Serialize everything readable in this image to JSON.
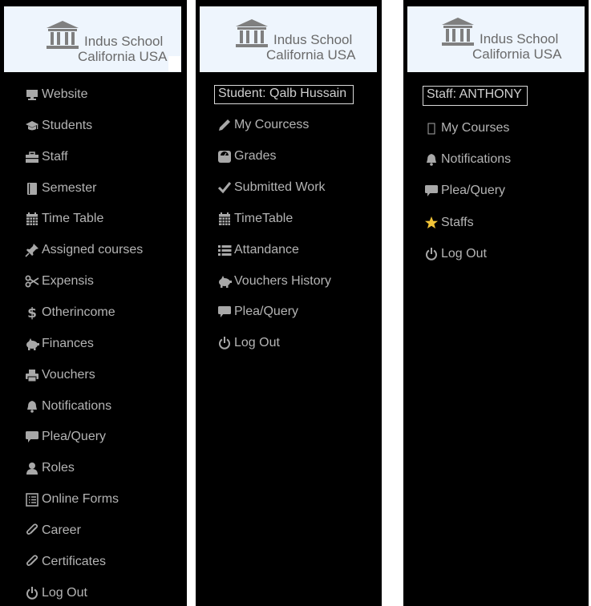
{
  "school": {
    "name": "Indus School",
    "location": "California USA"
  },
  "admin": {
    "items": [
      {
        "label": "Website",
        "icon": "monitor-icon"
      },
      {
        "label": "Students",
        "icon": "graduation-cap-icon"
      },
      {
        "label": "Staff",
        "icon": "briefcase-icon"
      },
      {
        "label": "Semester",
        "icon": "book-icon"
      },
      {
        "label": "Time Table",
        "icon": "calendar-icon"
      },
      {
        "label": "Assigned courses",
        "icon": "pin-icon"
      },
      {
        "label": "Expensis",
        "icon": "scissors-icon"
      },
      {
        "label": "Otherincome",
        "icon": "dollar-icon"
      },
      {
        "label": "Finances",
        "icon": "piggy-bank-icon"
      },
      {
        "label": "Vouchers",
        "icon": "printer-icon"
      },
      {
        "label": "Notifications",
        "icon": "bell-icon"
      },
      {
        "label": "Plea/Query",
        "icon": "comment-icon"
      },
      {
        "label": "Roles",
        "icon": "user-icon"
      },
      {
        "label": "Online Forms",
        "icon": "list-alt-icon"
      },
      {
        "label": "Career",
        "icon": "paperclip-icon"
      },
      {
        "label": "Certificates",
        "icon": "paperclip-icon"
      },
      {
        "label": "Log Out",
        "icon": "power-icon"
      }
    ]
  },
  "student": {
    "user_label": "Student: Qalb Hussain",
    "items": [
      {
        "label": "My Courcess",
        "icon": "pencil-icon"
      },
      {
        "label": "Grades",
        "icon": "scale-icon"
      },
      {
        "label": "Submitted Work",
        "icon": "check-icon"
      },
      {
        "label": "TimeTable",
        "icon": "calendar-icon"
      },
      {
        "label": "Attandance",
        "icon": "list-icon"
      },
      {
        "label": "Vouchers History",
        "icon": "piggy-bank-icon"
      },
      {
        "label": "Plea/Query",
        "icon": "comment-icon"
      },
      {
        "label": "Log Out",
        "icon": "power-icon"
      }
    ]
  },
  "staff": {
    "user_label": "Staff: ANTHONY",
    "items": [
      {
        "label": "My Courses",
        "icon": "missing-glyph-icon"
      },
      {
        "label": "Notifications",
        "icon": "bell-icon"
      },
      {
        "label": "Plea/Query",
        "icon": "comment-icon"
      },
      {
        "label": "Staffs",
        "icon": "star-icon"
      },
      {
        "label": "Log Out",
        "icon": "power-icon"
      }
    ]
  },
  "colors": {
    "panel": "#000000",
    "header": "#eef5fd",
    "text": "#b4b4b4",
    "star": "#f2c438"
  }
}
